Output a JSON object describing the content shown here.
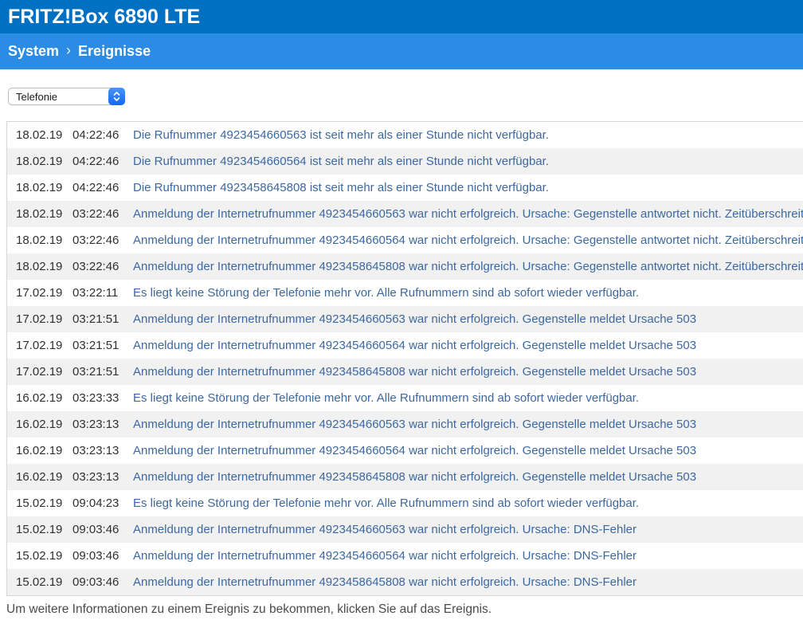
{
  "header": {
    "title": "FRITZ!Box 6890 LTE"
  },
  "breadcrumb": {
    "items": [
      "System",
      "Ereignisse"
    ],
    "separator": "›"
  },
  "filter": {
    "selected": "Telefonie"
  },
  "events": {
    "rows": [
      {
        "date": "18.02.19",
        "time": "04:22:46",
        "message": "Die Rufnummer 4923454660563 ist seit mehr als einer Stunde nicht verfügbar."
      },
      {
        "date": "18.02.19",
        "time": "04:22:46",
        "message": "Die Rufnummer 4923454660564 ist seit mehr als einer Stunde nicht verfügbar."
      },
      {
        "date": "18.02.19",
        "time": "04:22:46",
        "message": "Die Rufnummer 4923458645808 ist seit mehr als einer Stunde nicht verfügbar."
      },
      {
        "date": "18.02.19",
        "time": "03:22:46",
        "message": "Anmeldung der Internetrufnummer 4923454660563 war nicht erfolgreich. Ursache: Gegenstelle antwortet nicht. Zeitüberschreitung."
      },
      {
        "date": "18.02.19",
        "time": "03:22:46",
        "message": "Anmeldung der Internetrufnummer 4923454660564 war nicht erfolgreich. Ursache: Gegenstelle antwortet nicht. Zeitüberschreitung."
      },
      {
        "date": "18.02.19",
        "time": "03:22:46",
        "message": "Anmeldung der Internetrufnummer 4923458645808 war nicht erfolgreich. Ursache: Gegenstelle antwortet nicht. Zeitüberschreitung."
      },
      {
        "date": "17.02.19",
        "time": "03:22:11",
        "message": "Es liegt keine Störung der Telefonie mehr vor. Alle Rufnummern sind ab sofort wieder verfügbar."
      },
      {
        "date": "17.02.19",
        "time": "03:21:51",
        "message": "Anmeldung der Internetrufnummer 4923454660563 war nicht erfolgreich. Gegenstelle meldet Ursache 503"
      },
      {
        "date": "17.02.19",
        "time": "03:21:51",
        "message": "Anmeldung der Internetrufnummer 4923454660564 war nicht erfolgreich. Gegenstelle meldet Ursache 503"
      },
      {
        "date": "17.02.19",
        "time": "03:21:51",
        "message": "Anmeldung der Internetrufnummer 4923458645808 war nicht erfolgreich. Gegenstelle meldet Ursache 503"
      },
      {
        "date": "16.02.19",
        "time": "03:23:33",
        "message": "Es liegt keine Störung der Telefonie mehr vor. Alle Rufnummern sind ab sofort wieder verfügbar."
      },
      {
        "date": "16.02.19",
        "time": "03:23:13",
        "message": "Anmeldung der Internetrufnummer 4923454660563 war nicht erfolgreich. Gegenstelle meldet Ursache 503"
      },
      {
        "date": "16.02.19",
        "time": "03:23:13",
        "message": "Anmeldung der Internetrufnummer 4923454660564 war nicht erfolgreich. Gegenstelle meldet Ursache 503"
      },
      {
        "date": "16.02.19",
        "time": "03:23:13",
        "message": "Anmeldung der Internetrufnummer 4923458645808 war nicht erfolgreich. Gegenstelle meldet Ursache 503"
      },
      {
        "date": "15.02.19",
        "time": "09:04:23",
        "message": "Es liegt keine Störung der Telefonie mehr vor. Alle Rufnummern sind ab sofort wieder verfügbar."
      },
      {
        "date": "15.02.19",
        "time": "09:03:46",
        "message": "Anmeldung der Internetrufnummer 4923454660563 war nicht erfolgreich. Ursache: DNS-Fehler"
      },
      {
        "date": "15.02.19",
        "time": "09:03:46",
        "message": "Anmeldung der Internetrufnummer 4923454660564 war nicht erfolgreich. Ursache: DNS-Fehler"
      },
      {
        "date": "15.02.19",
        "time": "09:03:46",
        "message": "Anmeldung der Internetrufnummer 4923458645808 war nicht erfolgreich. Ursache: DNS-Fehler"
      }
    ]
  },
  "footer": {
    "hint": "Um weitere Informationen zu einem Ereignis zu bekommen, klicken Sie auf das Ereignis."
  },
  "colors": {
    "topbar_blue": "#0070c2",
    "breadcrumb_blue": "#2a8ce4",
    "link_blue": "#3c68a0",
    "alt_row_gray": "#f1f1f1",
    "stepper_blue": "#1e72f3"
  }
}
